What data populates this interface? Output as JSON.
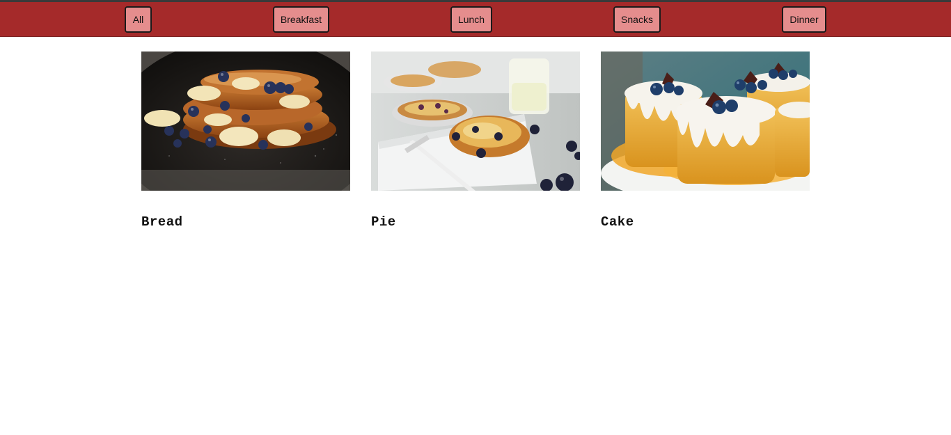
{
  "nav": {
    "buttons": [
      {
        "label": "All"
      },
      {
        "label": "Breakfast"
      },
      {
        "label": "Lunch"
      },
      {
        "label": "Snacks"
      },
      {
        "label": "Dinner"
      }
    ]
  },
  "colors": {
    "navbar": "#a52a2a",
    "button_bg": "#e58d8d",
    "button_border": "#1a1a1a",
    "page_bg": "#ffffff"
  },
  "menu": {
    "items": [
      {
        "title": "Bread",
        "image": "french-toast-with-blueberries-and-banana-photo"
      },
      {
        "title": "Pie",
        "image": "fruit-tart-with-fork-photo"
      },
      {
        "title": "Cake",
        "image": "iced-cakes-with-blueberries-photo"
      }
    ]
  }
}
